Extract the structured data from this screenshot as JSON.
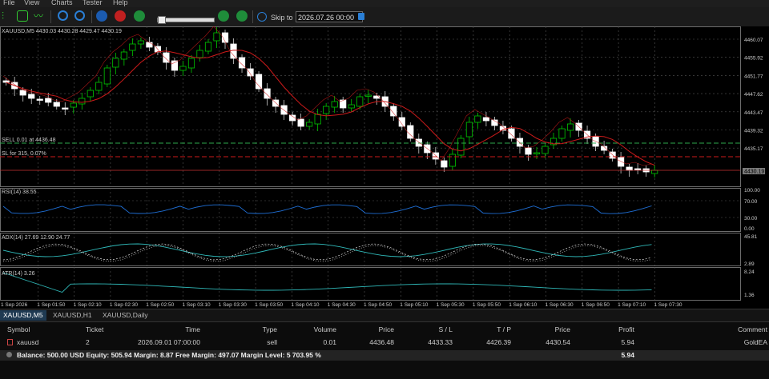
{
  "menu": {
    "file": "File",
    "view": "View",
    "charts": "Charts",
    "tester": "Tester",
    "help": "Help"
  },
  "toolbar": {
    "skip_to_label": "Skip to",
    "skip_to_value": "2026.07.26 00:00"
  },
  "chart": {
    "symbol_info": "XAUUSD,M5  4430.03  4430.28  4429.47  4430.19",
    "sell_label": "SELL 0.01 at 4436.48",
    "sl_label": "SL for 315, 0.07%",
    "current_price": "4430.19",
    "price_ticks": [
      "4460.07",
      "4455.92",
      "4451.77",
      "4447.62",
      "4443.47",
      "4439.32",
      "4435.17"
    ],
    "rsi_label": "RSI(14) 38.55",
    "rsi_ticks": [
      "100.00",
      "70.00",
      "30.00",
      "0.00"
    ],
    "adx_label": "ADX(14) 27.69 12.90 24.77",
    "adx_ticks": [
      "45.81",
      "2.89"
    ],
    "atr_label": "ATR(14) 3.26",
    "atr_ticks": [
      "8.24",
      "1.36"
    ],
    "time_labels": [
      "1 Sep 2026",
      "1 Sep 01:50",
      "1 Sep 02:10",
      "1 Sep 02:30",
      "1 Sep 02:50",
      "1 Sep 03:10",
      "1 Sep 03:30",
      "1 Sep 03:50",
      "1 Sep 04:10",
      "1 Sep 04:30",
      "1 Sep 04:50",
      "1 Sep 05:10",
      "1 Sep 05:30",
      "1 Sep 05:50",
      "1 Sep 06:10",
      "1 Sep 06:30",
      "1 Sep 06:50",
      "1 Sep 07:10",
      "1 Sep 07:30"
    ],
    "colors": {
      "bull": "#00c800",
      "bear": "#ffffff",
      "ma": "#cc1a1a",
      "rsi": "#1f6fd6",
      "adx_main": "#2fb8b8",
      "adx_dash": "#dddddd",
      "atr": "#2fb8b8",
      "sell_line": "#2ea84c",
      "sl_line": "#cc1a1a"
    }
  },
  "tabs": [
    "XAUUSD,M5",
    "XAUUSD,H1",
    "XAUUSD,Daily"
  ],
  "trade": {
    "headers": {
      "symbol": "Symbol",
      "ticket": "Ticket",
      "time": "Time",
      "type": "Type",
      "volume": "Volume",
      "price": "Price",
      "sl": "S / L",
      "tp": "T / P",
      "cur_price": "Price",
      "profit": "Profit",
      "comment": "Comment"
    },
    "row": {
      "symbol": "xauusd",
      "ticket": "2",
      "time": "2026.09.01 07:00:00",
      "type": "sell",
      "volume": "0.01",
      "price": "4436.48",
      "sl": "4433.33",
      "tp": "4426.39",
      "cur_price": "4430.54",
      "profit": "5.94",
      "comment": "GoldEA"
    },
    "balance": "Balance: 500.00 USD  Equity: 505.94  Margin: 8.87  Free Margin: 497.07  Margin Level: 5 703.95 %",
    "total_profit": "5.94"
  }
}
